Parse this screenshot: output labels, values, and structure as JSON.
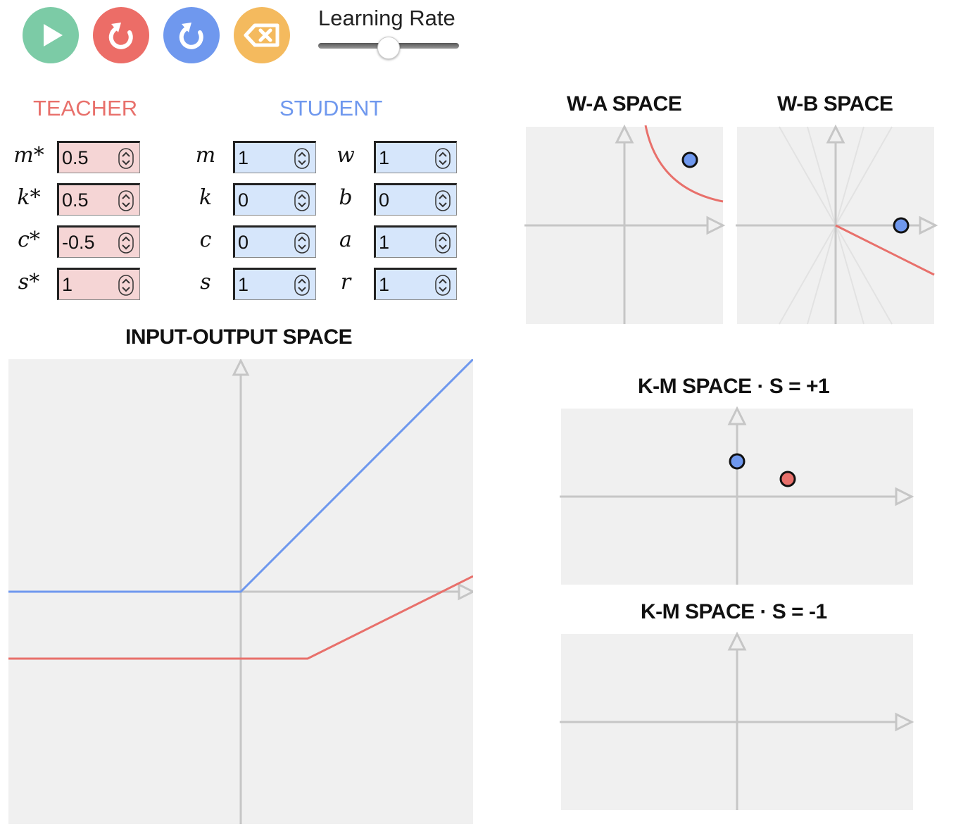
{
  "toolbar": {
    "play_color": "#7ccba6",
    "reset_teacher_color": "#ec6d67",
    "reset_student_color": "#6f98ee",
    "clear_color": "#f4ba5e",
    "learning_rate_label": "Learning Rate",
    "learning_rate_value": 0.5
  },
  "teacher": {
    "title": "TEACHER",
    "color": "#e8706b",
    "fields": [
      {
        "label": "m*",
        "value": "0.5"
      },
      {
        "label": "k*",
        "value": "0.5"
      },
      {
        "label": "c*",
        "value": "-0.5"
      },
      {
        "label": "s*",
        "value": "1"
      }
    ]
  },
  "student": {
    "title": "STUDENT",
    "color": "#6f98ee",
    "fields_left": [
      {
        "label": "m",
        "value": "1"
      },
      {
        "label": "k",
        "value": "0"
      },
      {
        "label": "c",
        "value": "0"
      },
      {
        "label": "s",
        "value": "1"
      }
    ],
    "fields_right": [
      {
        "label": "w",
        "value": "1"
      },
      {
        "label": "b",
        "value": "0"
      },
      {
        "label": "a",
        "value": "1"
      },
      {
        "label": "r",
        "value": "1"
      }
    ]
  },
  "panels": {
    "io_title": "INPUT-OUTPUT SPACE",
    "wa_title": "W-A SPACE",
    "wb_title": "W-B SPACE",
    "km_pos_title": "K-M SPACE · S = +1",
    "km_neg_title": "K-M SPACE · S = -1"
  }
}
